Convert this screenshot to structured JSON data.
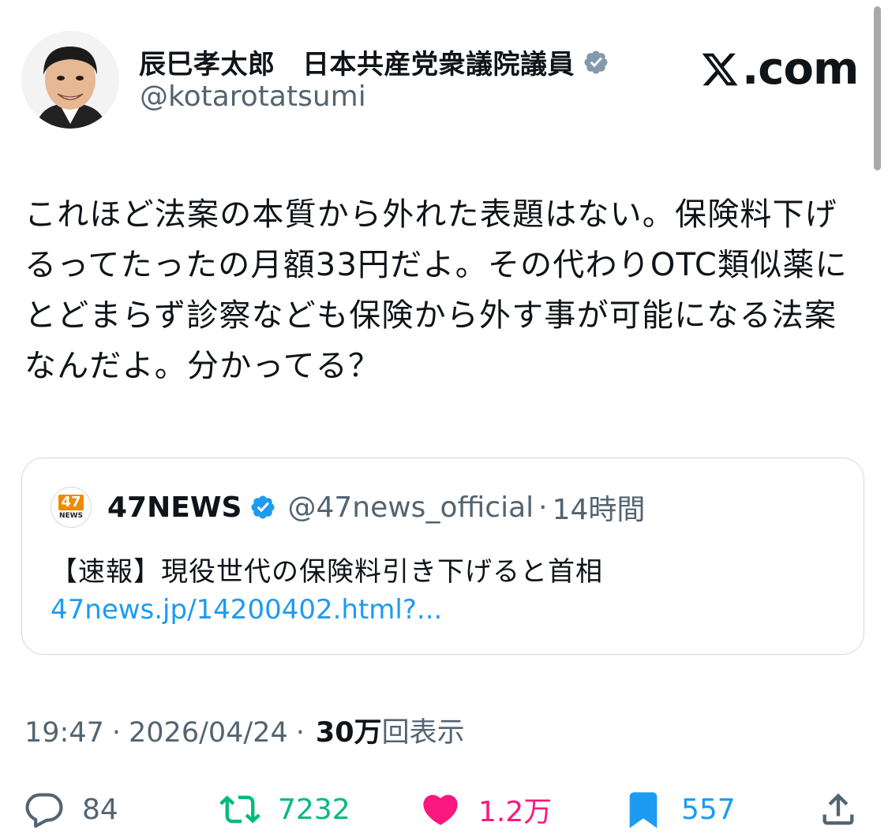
{
  "author": {
    "name": "辰巳孝太郎　日本共産党衆議院議員",
    "handle": "@kotarotatsumi"
  },
  "brand": {
    "label": ".com"
  },
  "tweet": {
    "text": "これほど法案の本質から外れた表題はない。保険料下げるってたったの月額33円だよ。その代わりOTC類似薬にとどまらず診察なども保険から外す事が可能になる法案なんだよ。分かってる？"
  },
  "quote": {
    "logo_number": "47",
    "logo_text": "NEWS",
    "name": "47NEWS",
    "handle": "@47news_official",
    "separator": "·",
    "time": "14時間",
    "text": "【速報】現役世代の保険料引き下げると首相",
    "link": "47news.jp/14200402.html?..."
  },
  "meta": {
    "time": "19:47",
    "separator": "·",
    "date": "2026/04/24",
    "views_count": "30万",
    "views_label": "回表示"
  },
  "actions": {
    "replies": "84",
    "retweets": "7232",
    "likes": "1.2万",
    "bookmarks": "557"
  },
  "colors": {
    "text": "#0f1419",
    "secondary": "#536471",
    "link": "#1d9bf0",
    "retweet": "#00ba7c",
    "like": "#f91880",
    "border": "#cfd9de",
    "verified_gray": "#829aab"
  }
}
